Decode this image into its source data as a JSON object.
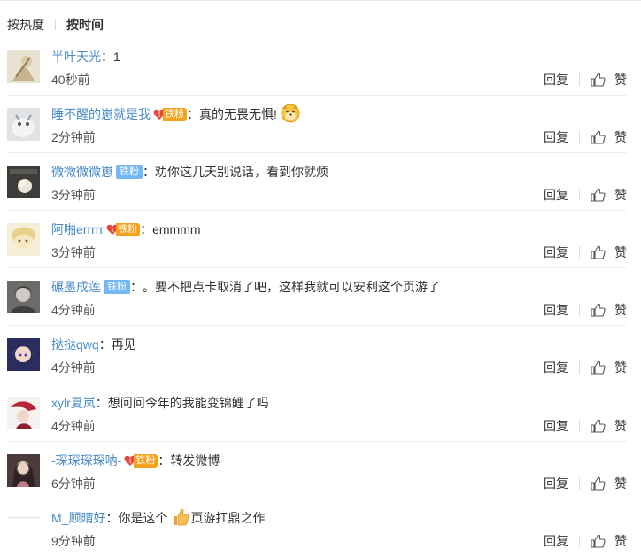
{
  "sort": {
    "hot": "按热度",
    "time": "按时间"
  },
  "actions": {
    "reply": "回复",
    "like": "赞"
  },
  "badge": {
    "label": "铁粉"
  },
  "colors": {
    "username": "#4a8cc7",
    "fan_blue": "#73b7f3",
    "fan_orange": "#f4a11c"
  },
  "comments": [
    {
      "user": "半叶天光",
      "text": "1",
      "time": "40秒前",
      "badge": "none"
    },
    {
      "user": "睡不醒的崽就是我",
      "text": "真的无畏无惧!",
      "time": "2分钟前",
      "badge": "heart",
      "emoji": "doge-emoji"
    },
    {
      "user": "微微微微崽",
      "text": "劝你这几天别说话，看到你就烦",
      "time": "3分钟前",
      "badge": "plain"
    },
    {
      "user": "阿啪errrrr",
      "text": "emmmm",
      "time": "3分钟前",
      "badge": "heart"
    },
    {
      "user": "碾墨成莲",
      "text": "。要不把点卡取消了吧，这样我就可以安利这个页游了",
      "time": "4分钟前",
      "badge": "plain"
    },
    {
      "user": "挞挞qwq",
      "text": "再见",
      "time": "4分钟前",
      "badge": "none"
    },
    {
      "user": "xylr夏岚",
      "text": "想问问今年的我能变锦鲤了吗",
      "time": "4分钟前",
      "badge": "none"
    },
    {
      "user": "-琛琛琛琛呐-",
      "text": "转发微博",
      "time": "6分钟前",
      "badge": "heart"
    },
    {
      "user": "M_顾晴好",
      "text": "你是这个",
      "text_after": "页游扛鼎之作",
      "time": "9分钟前",
      "badge": "none",
      "emoji": "thumbs-up-emoji"
    }
  ]
}
